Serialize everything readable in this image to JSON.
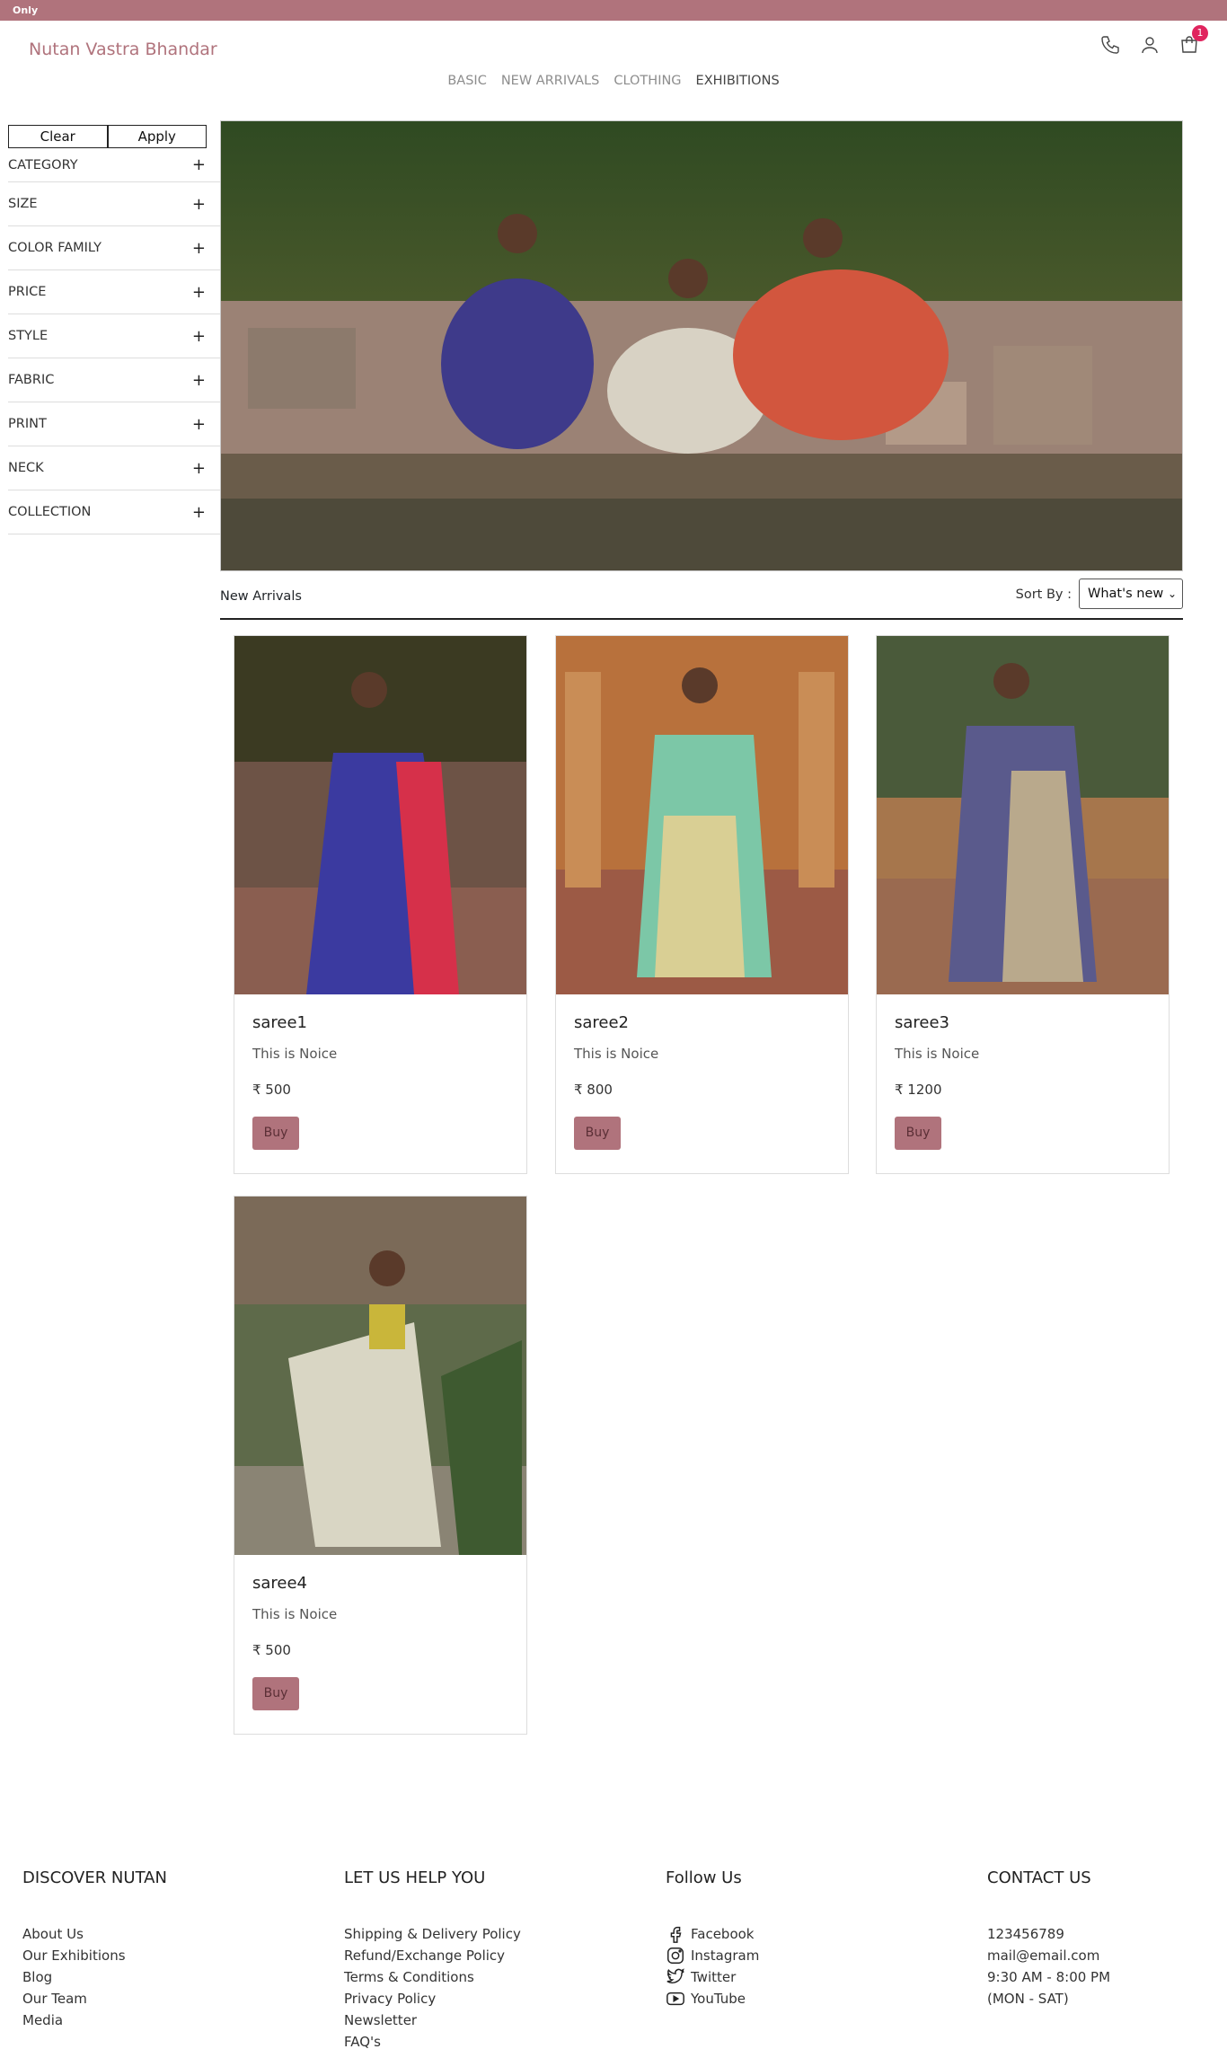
{
  "topbar": {
    "text": "Only"
  },
  "header": {
    "brand": "Nutan Vastra Bhandar",
    "cart_count": "1"
  },
  "nav": [
    "BASIC",
    "NEW ARRIVALS",
    "CLOTHING",
    "EXHIBITIONS"
  ],
  "filters": {
    "clear_label": "Clear",
    "apply_label": "Apply",
    "items": [
      "CATEGORY",
      "SIZE",
      "COLOR FAMILY",
      "PRICE",
      "STYLE",
      "FABRIC",
      "PRINT",
      "NECK",
      "COLLECTION"
    ],
    "expand_glyph": "+"
  },
  "listing": {
    "title": "New Arrivals",
    "sort_label": "Sort By :",
    "sort_value": "What's new"
  },
  "products": [
    {
      "name": "saree1",
      "desc": "This is Noice",
      "price": "₹ 500",
      "buy": "Buy"
    },
    {
      "name": "saree2",
      "desc": "This is Noice",
      "price": "₹ 800",
      "buy": "Buy"
    },
    {
      "name": "saree3",
      "desc": "This is Noice",
      "price": "₹ 1200",
      "buy": "Buy"
    },
    {
      "name": "saree4",
      "desc": "This is Noice",
      "price": "₹ 500",
      "buy": "Buy"
    }
  ],
  "footer": {
    "discover": {
      "title": "DISCOVER NUTAN",
      "links": [
        "About Us",
        "Our Exhibitions",
        "Blog",
        "Our Team",
        "Media"
      ]
    },
    "help": {
      "title": "LET US HELP YOU",
      "links": [
        "Shipping & Delivery Policy",
        "Refund/Exchange Policy",
        "Terms & Conditions",
        "Privacy Policy",
        "Newsletter",
        "FAQ's"
      ]
    },
    "follow": {
      "title": "Follow Us",
      "links": [
        "Facebook",
        "Instagram",
        "Twitter",
        "YouTube"
      ]
    },
    "contact": {
      "title": "CONTACT US",
      "lines": [
        "123456789",
        "mail@email.com",
        "9:30 AM - 8:00 PM",
        "(MON - SAT)"
      ]
    }
  },
  "colors": {
    "brand": "#b0737c",
    "badge": "#e0245e"
  }
}
